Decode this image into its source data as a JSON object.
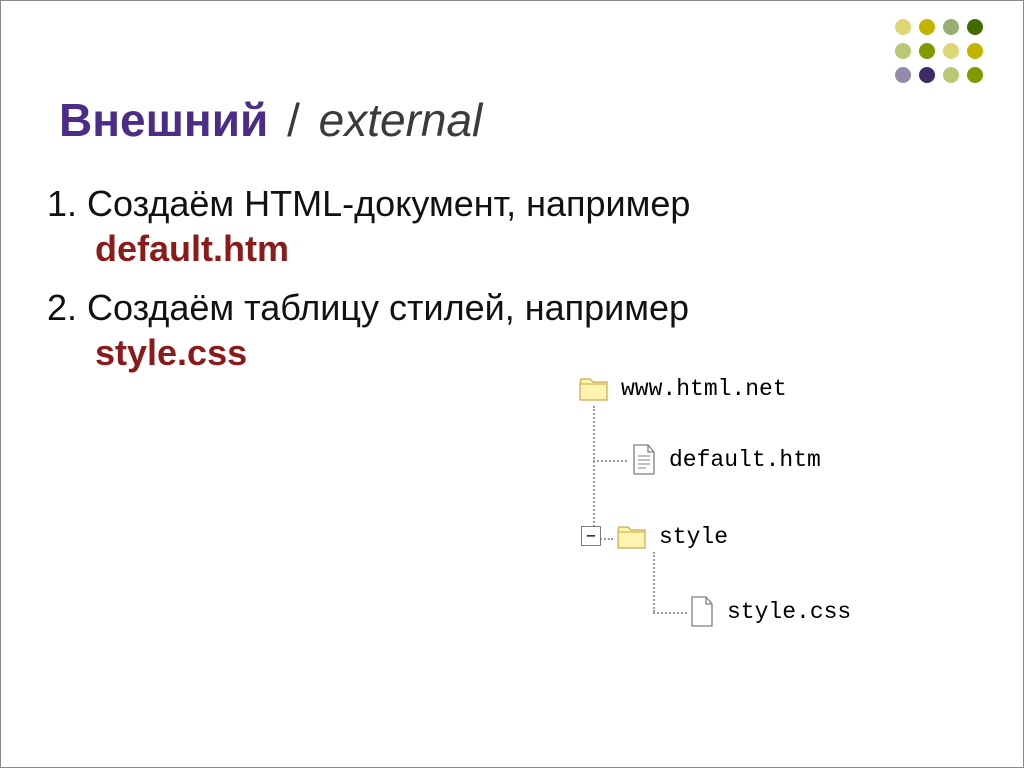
{
  "dot_colors": {
    "row1": [
      "#c2b400",
      "#c2b400",
      "#446b00",
      "#446b00"
    ],
    "row2": [
      "#7f9b00",
      "#7f9b00",
      "#c2b400",
      "#c2b400"
    ],
    "row3": [
      "#3e2a67",
      "#3e2a67",
      "#7f9b00",
      "#7f9b00"
    ]
  },
  "title": {
    "main": "Внешний",
    "separator": "/",
    "sub": "external"
  },
  "items": [
    {
      "num": "1.",
      "text": "Создаём HTML-документ, например",
      "highlight": "default.htm"
    },
    {
      "num": "2.",
      "text": "Создаём таблицу стилей, например",
      "highlight": "style.css"
    }
  ],
  "tree": {
    "root": "www.html.net",
    "file1": "default.htm",
    "folder": "style",
    "file2": "style.css",
    "expander": "−"
  }
}
